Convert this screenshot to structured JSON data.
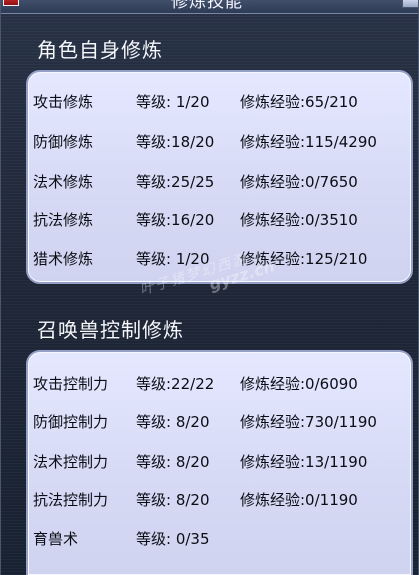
{
  "window": {
    "title": "修炼技能",
    "close_icon": "close-icon",
    "ornament_icon": "ornament-icon"
  },
  "sections": {
    "role": {
      "title": "角色自身修炼",
      "rows": [
        {
          "name": "攻击修炼",
          "level": "等级: 1/20",
          "exp": "修炼经验:65/210"
        },
        {
          "name": "防御修炼",
          "level": "等级:18/20",
          "exp": "修炼经验:115/4290"
        },
        {
          "name": "法术修炼",
          "level": "等级:25/25",
          "exp": "修炼经验:0/7650"
        },
        {
          "name": "抗法修炼",
          "level": "等级:16/20",
          "exp": "修炼经验:0/3510"
        },
        {
          "name": "猎术修炼",
          "level": "等级: 1/20",
          "exp": "修炼经验:125/210"
        }
      ]
    },
    "summon": {
      "title": "召唤兽控制修炼",
      "rows": [
        {
          "name": "攻击控制力",
          "level": "等级:22/22",
          "exp": "修炼经验:0/6090"
        },
        {
          "name": "防御控制力",
          "level": "等级: 8/20",
          "exp": "修炼经验:730/1190"
        },
        {
          "name": "法术控制力",
          "level": "等级: 8/20",
          "exp": "修炼经验:13/1190"
        },
        {
          "name": "抗法控制力",
          "level": "等级: 8/20",
          "exp": "修炼经验:0/1190"
        },
        {
          "name": "育兽术",
          "level": "等级: 0/35",
          "exp": ""
        }
      ]
    }
  },
  "watermark": {
    "text": "叶子猪梦幻西游",
    "site": "gyzz.cn"
  },
  "colors": {
    "window_bg": "#1f2738",
    "panel_bg": "#d6daf5",
    "panel_border": "#95a0c7",
    "heading_text": "#f6f7fb",
    "row_text": "#0b0e15"
  }
}
